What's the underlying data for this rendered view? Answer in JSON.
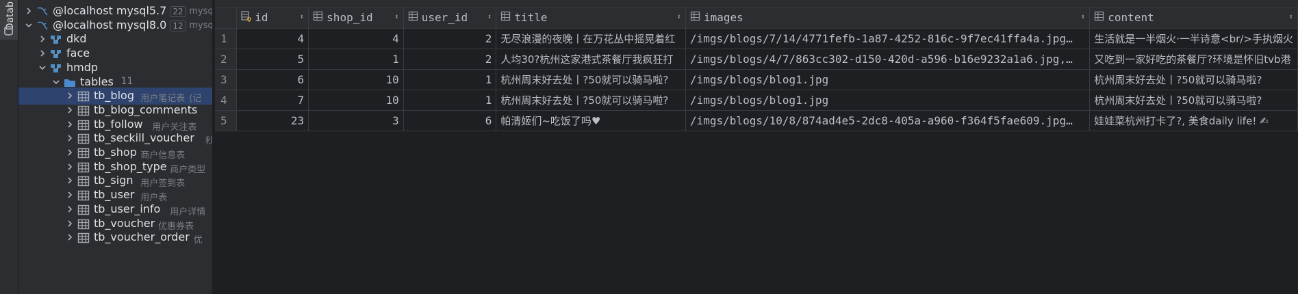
{
  "tool_window": {
    "label": "Datab"
  },
  "tree": {
    "nodes": [
      {
        "label": "@localhost mysql5.7",
        "badge": "22",
        "trail": "mysql",
        "kind": "connection",
        "expanded": false
      },
      {
        "label": "@localhost mysql8.0",
        "badge": "12",
        "trail": "mysql",
        "kind": "connection",
        "expanded": true
      },
      {
        "label": "dkd",
        "kind": "schema",
        "expanded": false
      },
      {
        "label": "face",
        "kind": "schema",
        "expanded": false
      },
      {
        "label": "hmdp",
        "kind": "schema",
        "expanded": true
      },
      {
        "label": "tables",
        "count": "11",
        "kind": "folder",
        "expanded": true
      },
      {
        "label": "tb_blog",
        "comment": "用户笔记表",
        "trail": "(记",
        "kind": "table",
        "selected": true
      },
      {
        "label": "tb_blog_comments",
        "comment": "",
        "trail": "",
        "kind": "table"
      },
      {
        "label": "tb_follow",
        "comment": "用户关注表",
        "kind": "table"
      },
      {
        "label": "tb_seckill_voucher",
        "comment": "",
        "trail": "秒",
        "kind": "table"
      },
      {
        "label": "tb_shop",
        "comment": "商户信息表",
        "kind": "table"
      },
      {
        "label": "tb_shop_type",
        "comment": "商户类型",
        "kind": "table"
      },
      {
        "label": "tb_sign",
        "comment": "用户签到表",
        "kind": "table"
      },
      {
        "label": "tb_user",
        "comment": "用户表",
        "kind": "table"
      },
      {
        "label": "tb_user_info",
        "comment": "用户详情",
        "kind": "table"
      },
      {
        "label": "tb_voucher",
        "comment": "优惠券表",
        "kind": "table"
      },
      {
        "label": "tb_voucher_order",
        "comment": "",
        "trail": "优",
        "kind": "table"
      }
    ]
  },
  "grid": {
    "columns": [
      {
        "name": "id",
        "key": true
      },
      {
        "name": "shop_id"
      },
      {
        "name": "user_id"
      },
      {
        "name": "title"
      },
      {
        "name": "images"
      },
      {
        "name": "content"
      }
    ],
    "rows": [
      {
        "n": "1",
        "id": "4",
        "shop_id": "4",
        "user_id": "2",
        "title": "无尽浪漫的夜晚丨在万花丛中摇晃着红",
        "images": "/imgs/blogs/7/14/4771fefb-1a87-4252-816c-9f7ec41ffa4a.jpg…",
        "content": "生活就是一半烟火·一半诗意<br/>手执烟火"
      },
      {
        "n": "2",
        "id": "5",
        "shop_id": "1",
        "user_id": "2",
        "title": "人均30?杭州这家港式茶餐厅我疯狂打",
        "images": "/imgs/blogs/4/7/863cc302-d150-420d-a596-b16e9232a1a6.jpg,…",
        "content": "又吃到一家好吃的茶餐厅?环境是怀旧tvb港"
      },
      {
        "n": "3",
        "id": "6",
        "shop_id": "10",
        "user_id": "1",
        "title": "杭州周末好去处丨?50就可以骑马啦?",
        "images": "/imgs/blogs/blog1.jpg",
        "content": "杭州周末好去处丨?50就可以骑马啦?"
      },
      {
        "n": "4",
        "id": "7",
        "shop_id": "10",
        "user_id": "1",
        "title": "杭州周末好去处丨?50就可以骑马啦?",
        "images": "/imgs/blogs/blog1.jpg",
        "content": "杭州周末好去处丨?50就可以骑马啦?"
      },
      {
        "n": "5",
        "id": "23",
        "shop_id": "3",
        "user_id": "6",
        "title": "帕清姬们~吃饭了吗♥",
        "images": "/imgs/blogs/10/8/874ad4e5-2dc8-405a-a960-f364f5fae609.jpg…",
        "content": "娃娃菜杭州打卡了?, 美食daily life! ✍"
      }
    ]
  },
  "colors": {
    "selection": "#2e436e",
    "table_icon": "#a8adb5",
    "folder_icon": "#4b8ccf",
    "schema_icon": "#4e8ec9"
  }
}
